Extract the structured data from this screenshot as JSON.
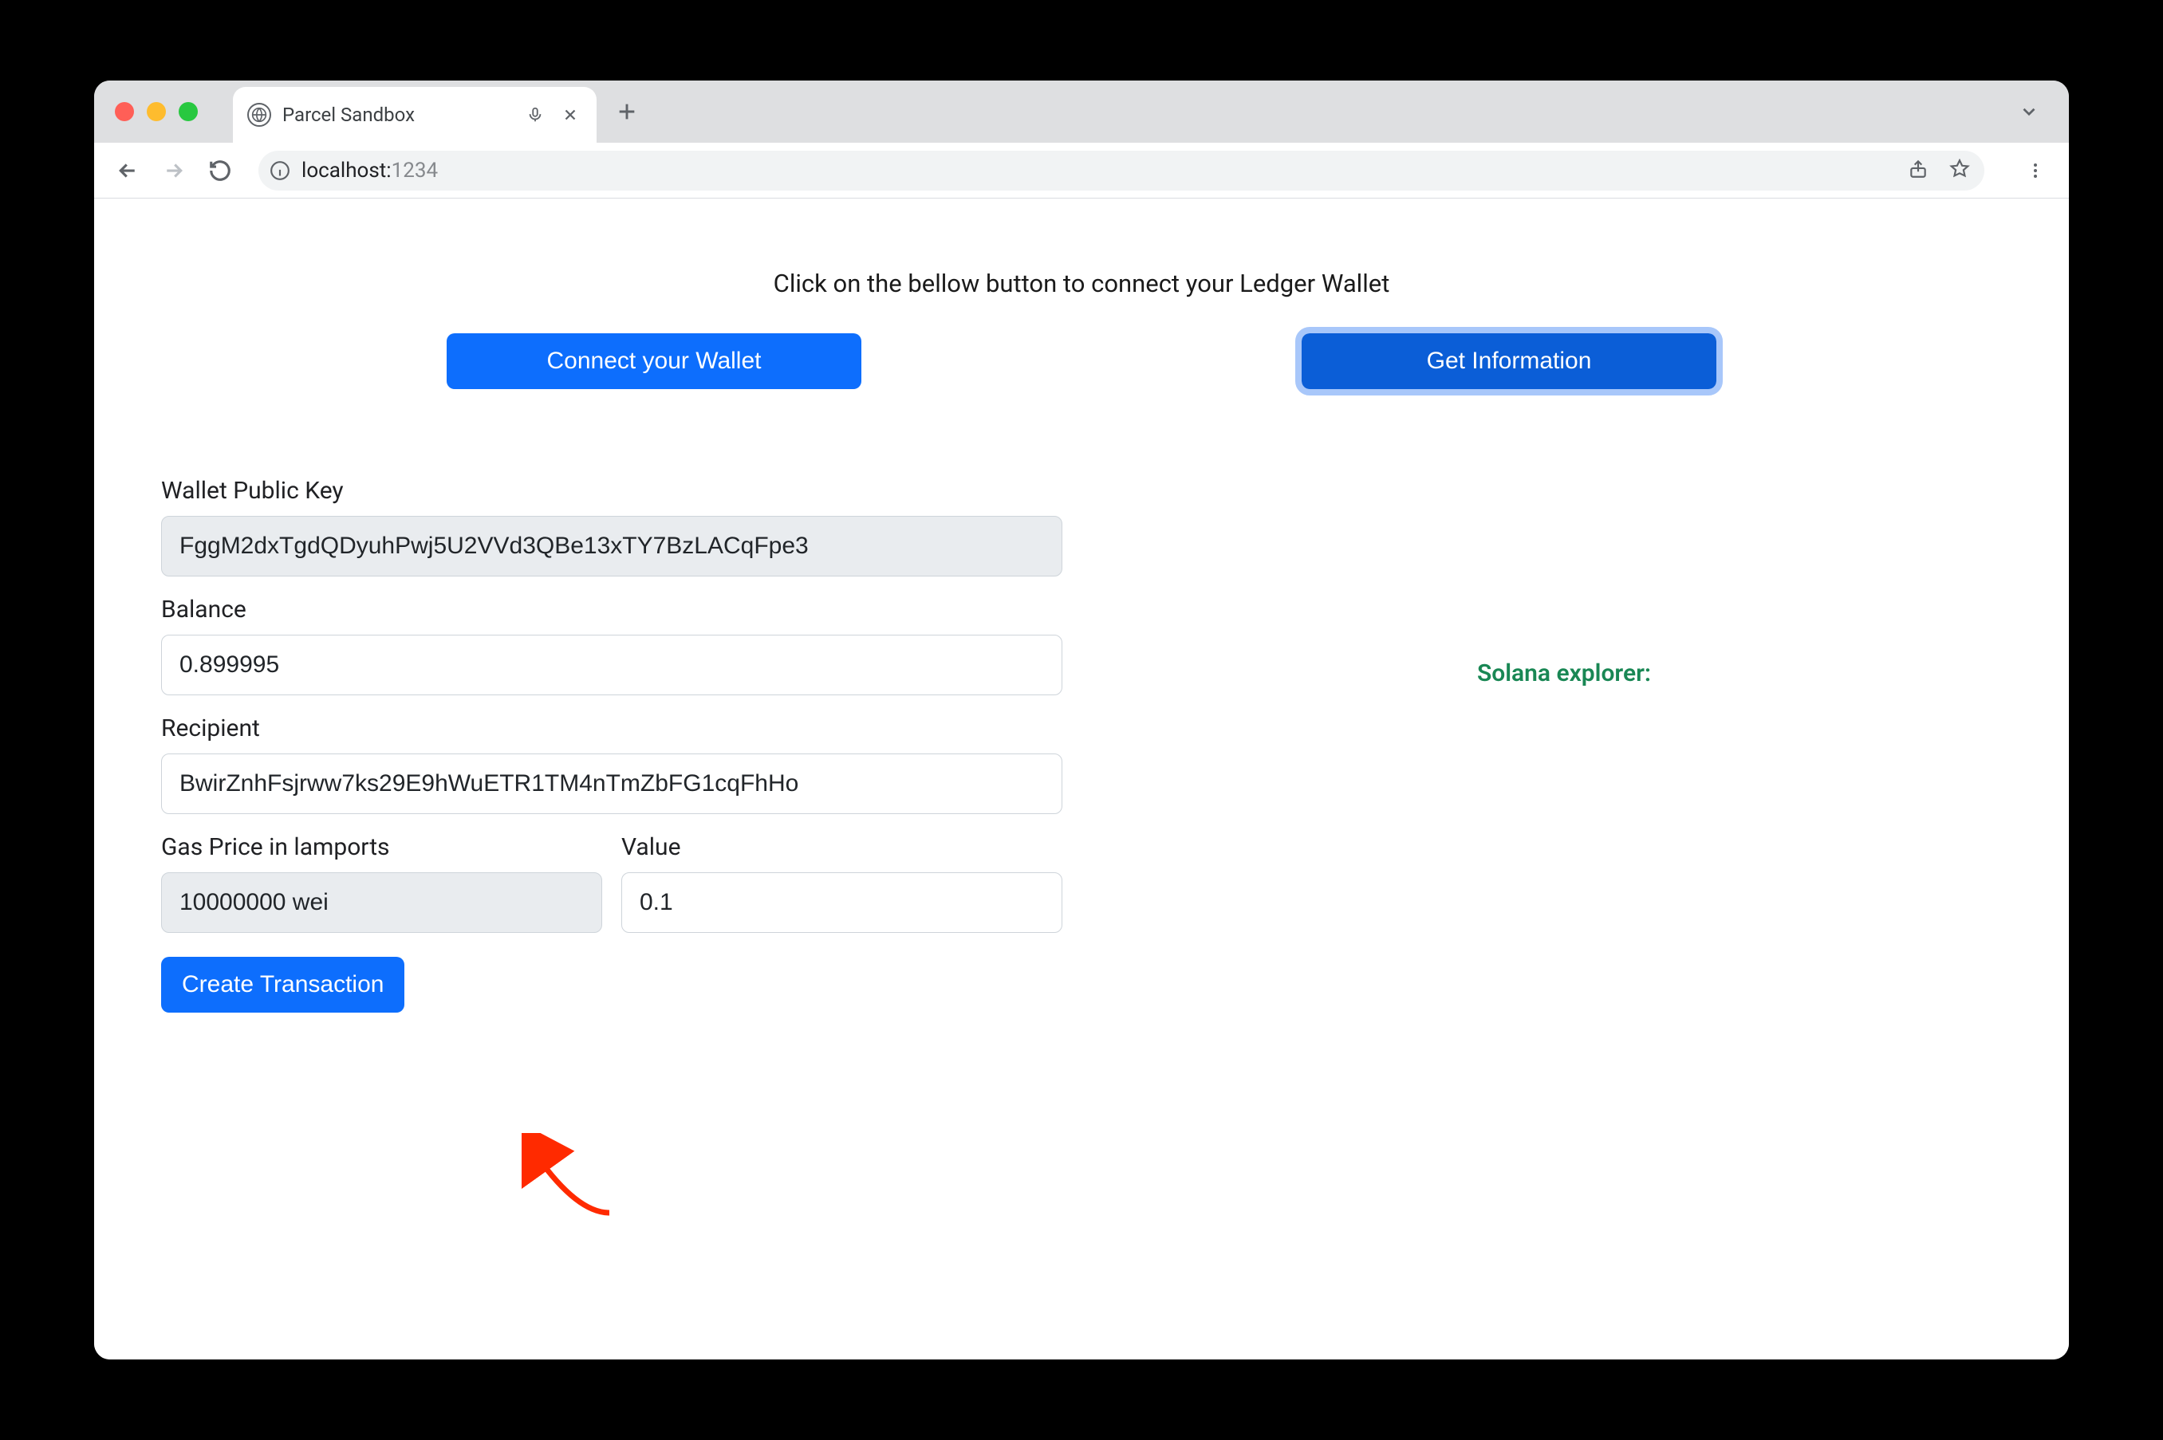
{
  "browser": {
    "tab_title": "Parcel Sandbox",
    "url_host": "localhost:",
    "url_port": "1234"
  },
  "header": {
    "instruction": "Click on the bellow button to connect your Ledger Wallet",
    "connect_label": "Connect your Wallet",
    "getinfo_label": "Get Information"
  },
  "form": {
    "pubkey_label": "Wallet Public Key",
    "pubkey_value": "FggM2dxTgdQDyuhPwj5U2VVd3QBe13xTY7BzLACqFpe3",
    "balance_label": "Balance",
    "balance_value": "0.899995",
    "recipient_label": "Recipient",
    "recipient_value": "BwirZnhFsjrww7ks29E9hWuETR1TM4nTmZbFG1cqFhHo",
    "gas_label": "Gas Price in lamports",
    "gas_value": "10000000 wei",
    "value_label": "Value",
    "value_value": "0.1",
    "create_label": "Create Transaction"
  },
  "side": {
    "explorer_text": "Solana explorer:"
  }
}
